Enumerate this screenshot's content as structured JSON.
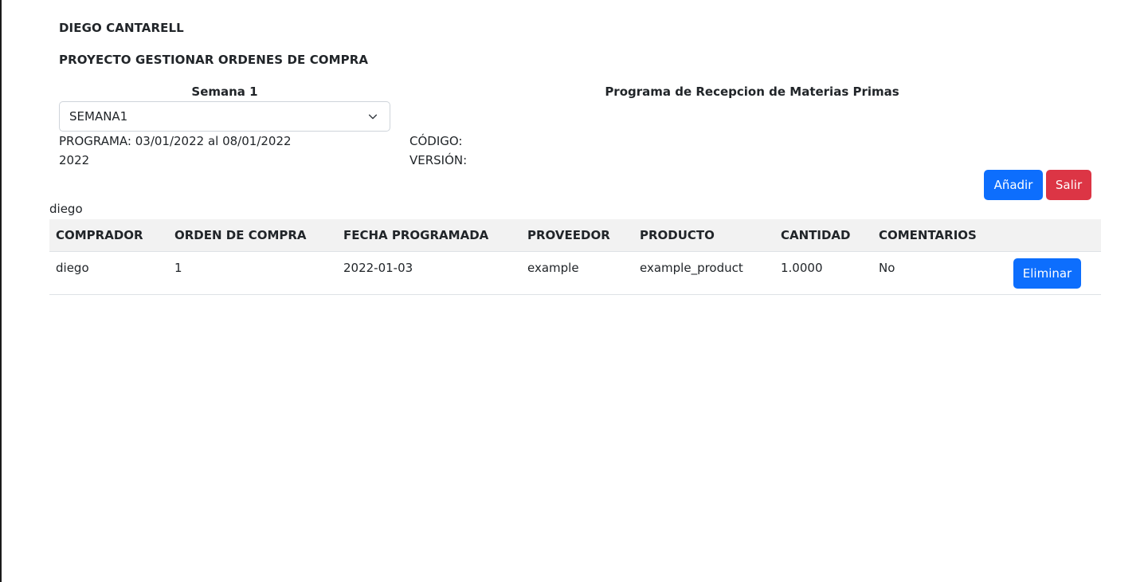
{
  "header": {
    "name": "DIEGO CANTARELL",
    "project": "PROYECTO GESTIONAR ORDENES DE COMPRA"
  },
  "week": {
    "title": "Semana 1",
    "selected": "SEMANA1"
  },
  "program_title": "Programa de Recepcion de Materias Primas",
  "info": {
    "programa": "PROGRAMA: 03/01/2022 al 08/01/2022",
    "year": "2022",
    "codigo": "CÓDIGO:",
    "version": "VERSIÓN:"
  },
  "actions": {
    "add_label": "Añadir",
    "exit_label": "Salir"
  },
  "user_label": "diego",
  "table": {
    "headers": [
      "COMPRADOR",
      "ORDEN DE COMPRA",
      "FECHA PROGRAMADA",
      "PROVEEDOR",
      "PRODUCTO",
      "CANTIDAD",
      "COMENTARIOS",
      ""
    ],
    "rows": [
      {
        "comprador": "diego",
        "orden": "1",
        "fecha": "2022-01-03",
        "proveedor": "example",
        "producto": "example_product",
        "cantidad": "1.0000",
        "comentarios": "No",
        "delete_label": "Eliminar"
      }
    ]
  },
  "colors": {
    "primary": "#0d6efd",
    "danger": "#dc3545",
    "header_bg": "#f2f2f2"
  }
}
